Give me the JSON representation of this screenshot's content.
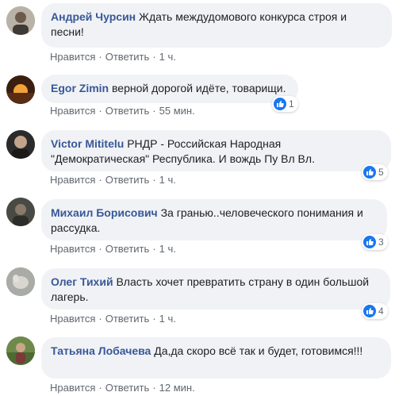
{
  "actions": {
    "like": "Нравится",
    "reply": "Ответить"
  },
  "comments": [
    {
      "author": "Андрей Чурсин",
      "text": "Ждать междудомового конкурса строя и песни!",
      "time": "1 ч.",
      "reactions": ""
    },
    {
      "author": "Egor Zimin",
      "text": "верной дорогой идёте, товарищи.",
      "time": "55 мин.",
      "reactions": "1"
    },
    {
      "author": "Victor Mititelu",
      "text": "РНДР - Российская Народная \"Демократическая\" Республика. И вождь Пу Вл Вл.",
      "time": "1 ч.",
      "reactions": "5"
    },
    {
      "author": "Михаил Борисович",
      "text": "За гранью..человеческого понимания и рассудка.",
      "time": "1 ч.",
      "reactions": "3"
    },
    {
      "author": "Олег Тихий",
      "text": "Власть хочет превратить страну в один большой лагерь.",
      "time": "1 ч.",
      "reactions": "4"
    },
    {
      "author": "Татьяна Лобачева",
      "text": "Да,да скоро всё так и будет, готовимся!!!",
      "time": "12 мин.",
      "reactions": ""
    }
  ]
}
